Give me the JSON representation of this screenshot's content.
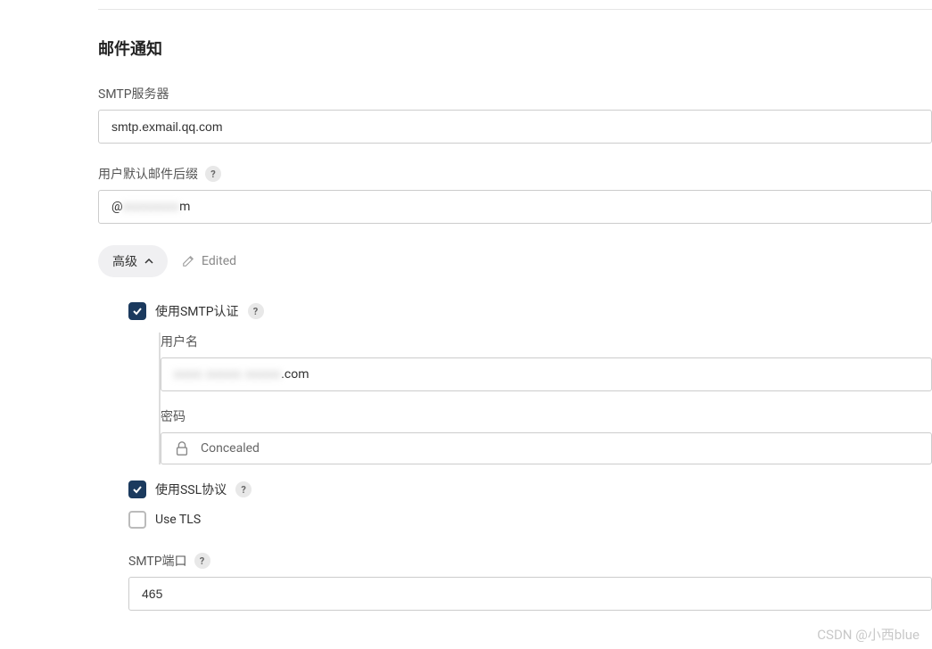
{
  "section_title": "邮件通知",
  "smtp_server": {
    "label": "SMTP服务器",
    "value": "smtp.exmail.qq.com"
  },
  "default_suffix": {
    "label": "用户默认邮件后缀",
    "prefix": "@",
    "blurred": "xxxxxxxx",
    "suffix": "m"
  },
  "advanced": {
    "toggle_label": "高级",
    "edited_label": "Edited"
  },
  "smtp_auth": {
    "label": "使用SMTP认证",
    "checked": true,
    "username_label": "用户名",
    "username_blurred": "xxxx xxxxx xxxxx",
    "username_suffix": ".com",
    "password_label": "密码",
    "password_value": "Concealed"
  },
  "ssl": {
    "label": "使用SSL协议",
    "checked": true
  },
  "tls": {
    "label": "Use TLS",
    "checked": false
  },
  "smtp_port": {
    "label": "SMTP端口",
    "value": "465"
  },
  "watermark": "CSDN @小西blue"
}
